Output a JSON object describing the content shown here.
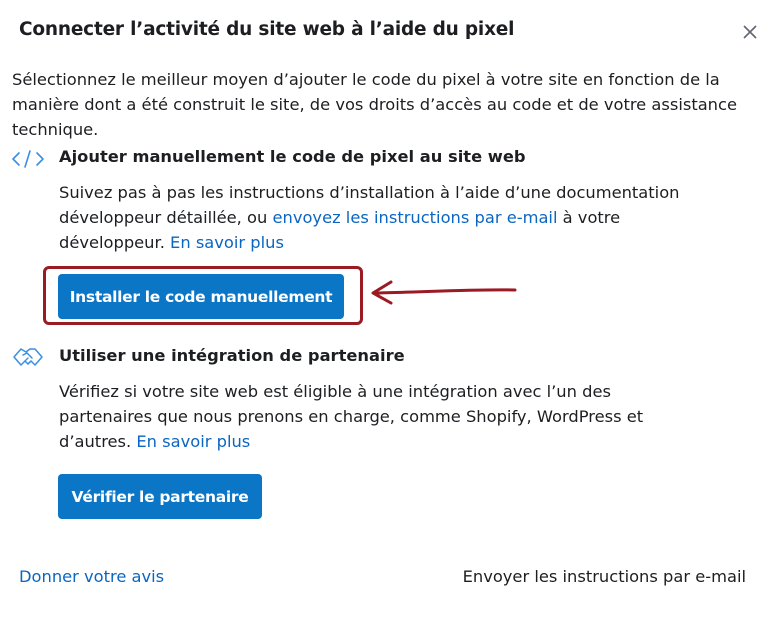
{
  "dialog": {
    "title": "Connecter l’activité du site web à l’aide du pixel",
    "intro": "Sélectionnez le meilleur moyen d’ajouter le code du pixel à votre site en fonction de la manière dont a été construit le site, de vos droits d’accès au code et de votre assistance technique."
  },
  "manual": {
    "icon": "code-icon",
    "title": "Ajouter manuellement le code de pixel au site web",
    "text_before": "Suivez pas à pas les instructions d’installation à l’aide d’une documentation développeur détaillée, ou ",
    "email_link": "envoyez les instructions par e-mail",
    "text_after": " à votre développeur. ",
    "learn_more": "En savoir plus",
    "button_label": "Installer le code manuellement"
  },
  "partner": {
    "icon": "handshake-icon",
    "title": "Utiliser une intégration de partenaire",
    "text": "Vérifiez si votre site web est éligible à une intégration avec l’un des partenaires que nous prenons en charge, comme Shopify, WordPress et d’autres. ",
    "learn_more": "En savoir plus",
    "button_label": "Vérifier le partenaire"
  },
  "footer": {
    "feedback_link": "Donner votre avis",
    "email_instructions": "Envoyer les instructions par e-mail"
  },
  "colors": {
    "primary_button": "#0b75c6",
    "link": "#0a66c2",
    "annotation": "#9b1b24"
  }
}
